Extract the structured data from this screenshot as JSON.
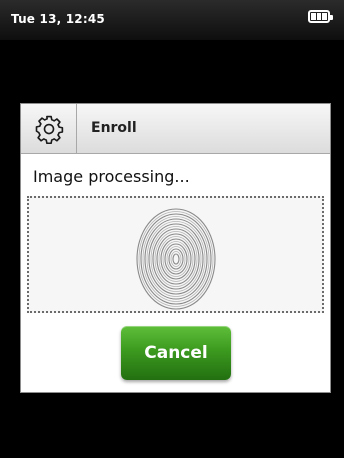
{
  "status_bar": {
    "time": "Tue 13, 12:45",
    "battery_icon": "battery-full-icon",
    "battery_level": 1.0
  },
  "dialog": {
    "icon": "gear-icon",
    "title": "Enroll",
    "status_text": "Image processing...",
    "scan_image": "fingerprint-image",
    "cancel_label": "Cancel",
    "cancel_color": "#3c9a1f"
  }
}
